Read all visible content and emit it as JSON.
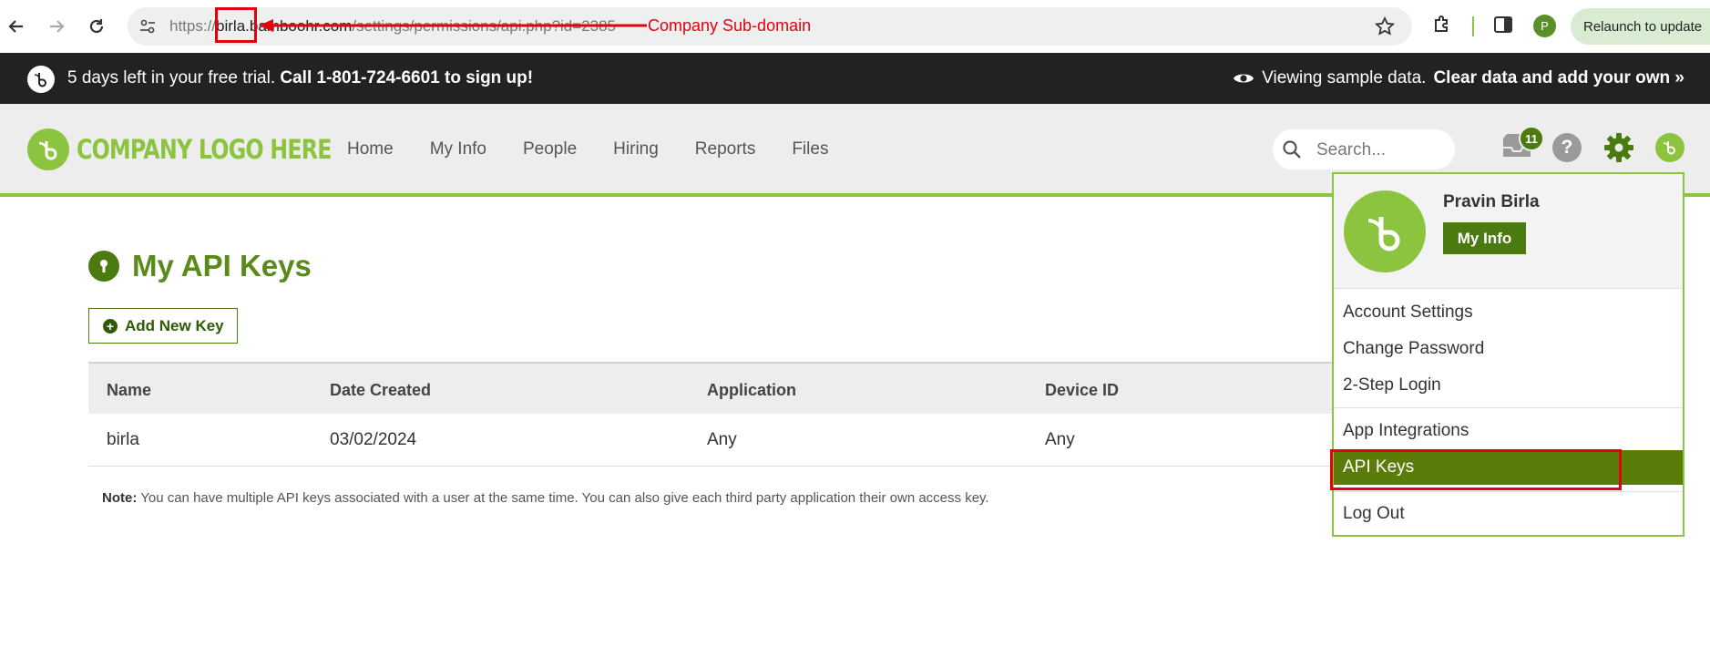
{
  "browser": {
    "url_prefix": "https://",
    "url_highlight": "birla",
    "url_host_rest": ".bamboohr.com",
    "url_path": "/settings/permissions/api.php?id=2385",
    "relaunch_label": "Relaunch to update",
    "profile_initial": "P"
  },
  "annotation": {
    "label": "Company Sub-domain",
    "color": "#e3000f"
  },
  "trial_bar": {
    "text_plain": "5 days left in your free trial.",
    "text_bold": "Call 1-801-724-6601 to sign up!",
    "right_plain": "Viewing sample data.",
    "right_bold": "Clear data and add your own »"
  },
  "header": {
    "logo_text": "COMPANY LOGO HERE",
    "nav": [
      "Home",
      "My Info",
      "People",
      "Hiring",
      "Reports",
      "Files"
    ],
    "search_placeholder": "Search...",
    "inbox_count": "11",
    "help_glyph": "?"
  },
  "page": {
    "title": "My API Keys",
    "add_button": "Add New Key",
    "table": {
      "headers": [
        "Name",
        "Date Created",
        "Application",
        "Device ID"
      ],
      "rows": [
        [
          "birla",
          "03/02/2024",
          "Any",
          "Any"
        ]
      ]
    },
    "note_label": "Note:",
    "note_text": "You can have multiple API keys associated with a user at the same time. You can also give each third party application their own access key."
  },
  "dropdown": {
    "user_name": "Pravin Birla",
    "my_info": "My Info",
    "items": [
      "Account Settings",
      "Change Password",
      "2-Step Login",
      "App Integrations",
      "API Keys",
      "Log Out"
    ]
  },
  "colors": {
    "brand_green": "#8cc43f",
    "dark_green": "#4a7a10",
    "trial_bg": "#222222"
  }
}
